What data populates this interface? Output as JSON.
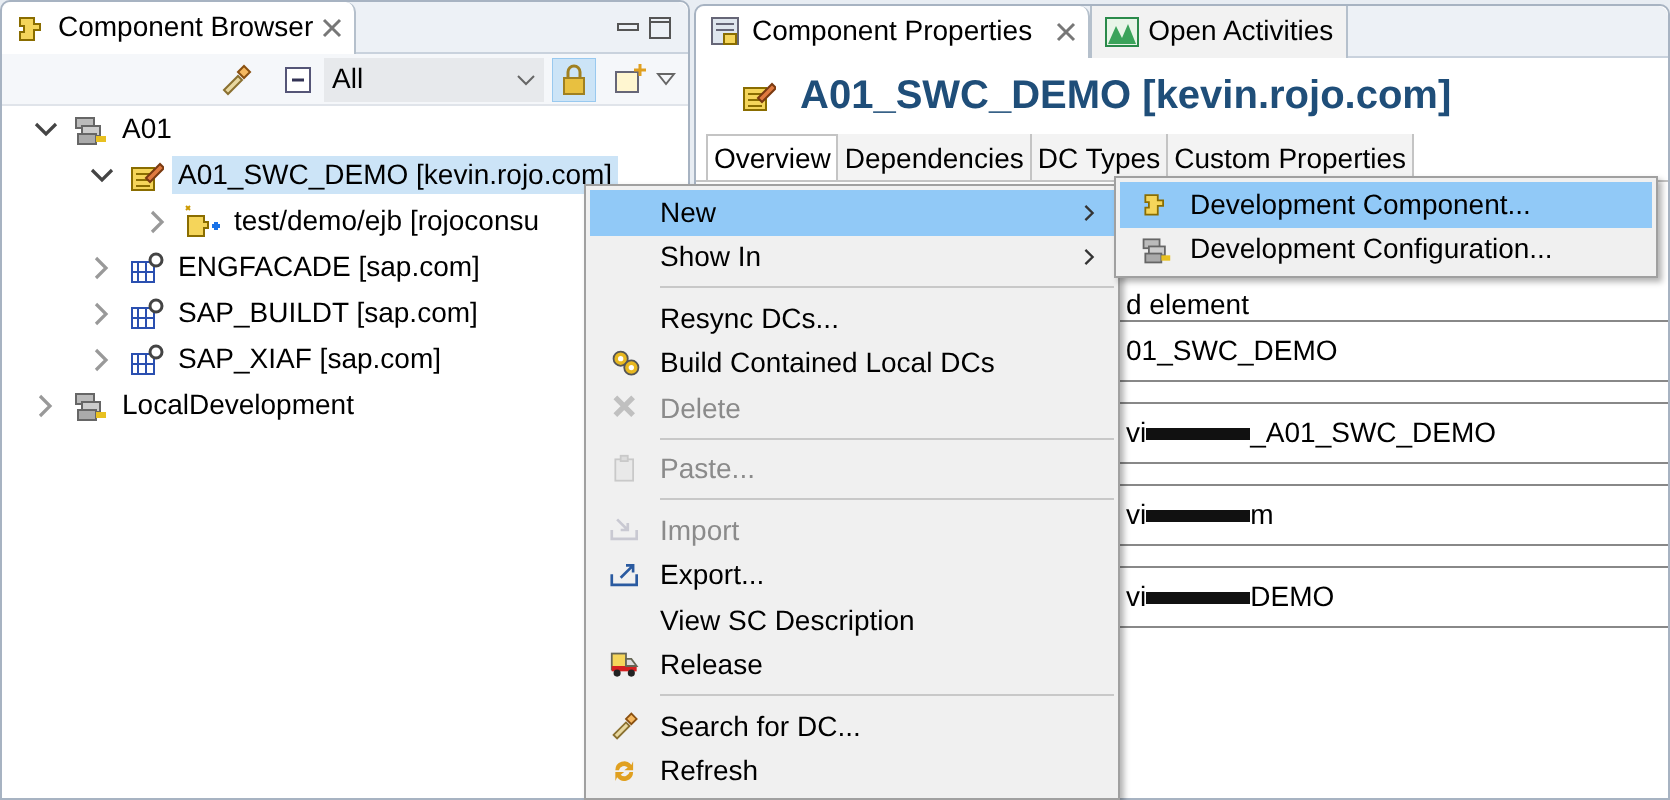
{
  "browser": {
    "title": "Component Browser",
    "filter": "All",
    "tree": [
      {
        "label": "A01",
        "kind": "configuration",
        "expanded": true,
        "selected": false,
        "children": [
          {
            "label": "A01_SWC_DEMO [kevin.rojo.com]",
            "kind": "editable",
            "expanded": true,
            "selected": true,
            "children": [
              {
                "label": "test/demo/ejb [rojoconsu",
                "kind": "development",
                "expanded": false,
                "selected": false
              }
            ]
          },
          {
            "label": "ENGFACADE [sap.com]",
            "kind": "software",
            "expanded": false,
            "selected": false
          },
          {
            "label": "SAP_BUILDT [sap.com]",
            "kind": "software",
            "expanded": false,
            "selected": false
          },
          {
            "label": "SAP_XIAF [sap.com]",
            "kind": "software",
            "expanded": false,
            "selected": false
          }
        ]
      },
      {
        "label": "LocalDevelopment",
        "kind": "configuration",
        "expanded": false,
        "selected": false
      }
    ]
  },
  "properties": {
    "tabs": [
      {
        "label": "Component Properties",
        "selected": true
      },
      {
        "label": "Open Activities",
        "selected": false
      }
    ],
    "heading": "A01_SWC_DEMO [kevin.rojo.com]",
    "subtabs": [
      {
        "label": "Overview",
        "selected": true
      },
      {
        "label": "Dependencies",
        "selected": false
      },
      {
        "label": "DC Types",
        "selected": false
      },
      {
        "label": "Custom Properties",
        "selected": false
      }
    ],
    "fields": [
      {
        "kind": "plain",
        "parts": [
          {
            "kind": "text",
            "text": "d element"
          }
        ]
      },
      {
        "kind": "boxed",
        "parts": [
          {
            "kind": "text",
            "text": "01_SWC_DEMO"
          }
        ]
      },
      {
        "kind": "boxed",
        "parts": [
          {
            "kind": "text",
            "text": "vi"
          },
          {
            "kind": "redaction"
          },
          {
            "kind": "text",
            "text": "_A01_SWC_DEMO"
          }
        ]
      },
      {
        "kind": "boxed",
        "parts": [
          {
            "kind": "text",
            "text": "vi"
          },
          {
            "kind": "redaction"
          },
          {
            "kind": "text",
            "text": "m"
          }
        ]
      },
      {
        "kind": "boxed",
        "parts": [
          {
            "kind": "text",
            "text": "vi"
          },
          {
            "kind": "redaction"
          },
          {
            "kind": "text",
            "text": "DEMO"
          }
        ]
      }
    ]
  },
  "context_menu": {
    "items": [
      {
        "kind": "text",
        "label": "New",
        "submenu": true,
        "selected": true,
        "disabled": false
      },
      {
        "kind": "text",
        "label": "Show In",
        "submenu": true,
        "selected": false,
        "disabled": false
      },
      {
        "kind": "separator"
      },
      {
        "kind": "text",
        "label": "Resync DCs...",
        "selected": false,
        "disabled": false
      },
      {
        "kind": "build",
        "label": "Build Contained Local DCs",
        "selected": false,
        "disabled": false
      },
      {
        "kind": "delete",
        "label": "Delete",
        "selected": false,
        "disabled": true
      },
      {
        "kind": "separator"
      },
      {
        "kind": "paste",
        "label": "Paste...",
        "selected": false,
        "disabled": true
      },
      {
        "kind": "separator"
      },
      {
        "kind": "import",
        "label": "Import",
        "selected": false,
        "disabled": true
      },
      {
        "kind": "export",
        "label": "Export...",
        "selected": false,
        "disabled": false
      },
      {
        "kind": "text",
        "label": "View SC Description",
        "selected": false,
        "disabled": false
      },
      {
        "kind": "release",
        "label": "Release",
        "selected": false,
        "disabled": false
      },
      {
        "kind": "separator"
      },
      {
        "kind": "search",
        "label": "Search for DC...",
        "selected": false,
        "disabled": false
      },
      {
        "kind": "refresh",
        "label": "Refresh",
        "selected": false,
        "disabled": false
      }
    ]
  },
  "submenu": {
    "items": [
      {
        "kind": "component",
        "label": "Development Component...",
        "selected": true,
        "disabled": false
      },
      {
        "kind": "configuration",
        "label": "Development Configuration...",
        "selected": false,
        "disabled": false
      }
    ]
  }
}
